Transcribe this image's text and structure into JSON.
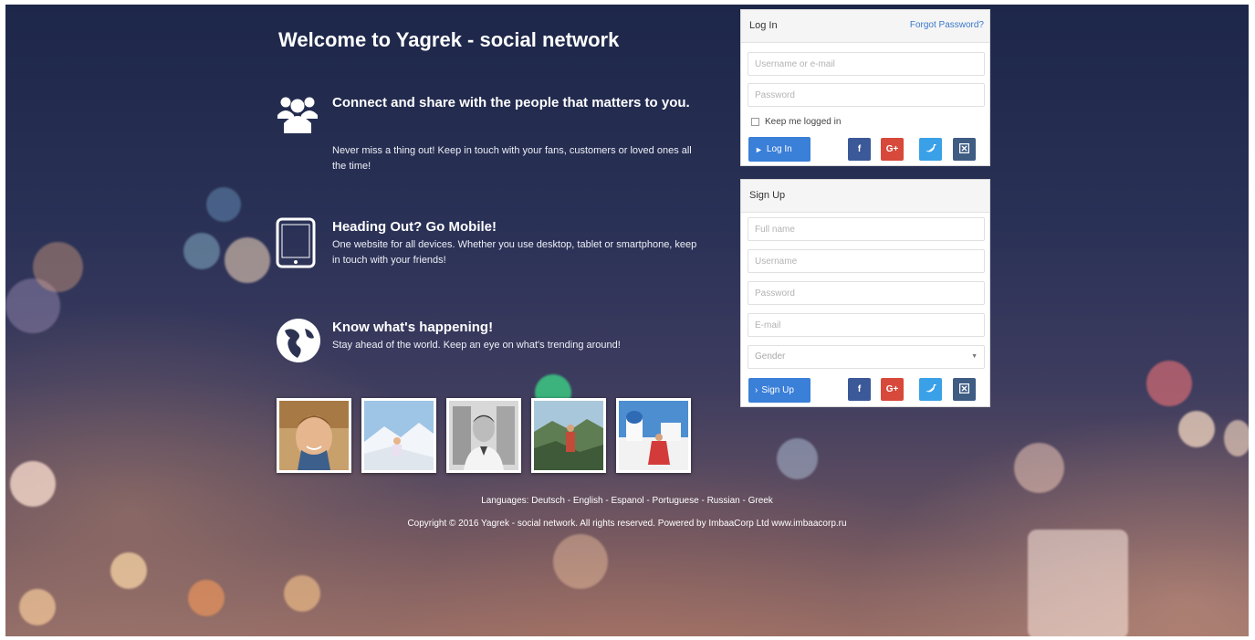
{
  "page": {
    "title": "Welcome to Yagrek - social network"
  },
  "features": [
    {
      "icon": "users-icon",
      "heading": "Connect and share with the people that matters to you.",
      "text": "Never miss a thing out! Keep in touch with your fans, customers or loved ones all the time!"
    },
    {
      "icon": "tablet-icon",
      "heading": "Heading Out? Go Mobile!",
      "text": "One website for all devices. Whether you use desktop, tablet or smartphone, keep in touch with your friends!"
    },
    {
      "icon": "globe-icon",
      "heading": "Know what's happening!",
      "text": "Stay ahead of the world. Keep an eye on what's trending around!"
    }
  ],
  "login": {
    "title": "Log In",
    "forgot_link": "Forgot Password?",
    "username_placeholder": "Username or e-mail",
    "password_placeholder": "Password",
    "remember_label": "Keep me logged in",
    "submit_label": "Log In",
    "submit_icon": "sign-in-icon",
    "social": [
      "f",
      "G+",
      "twitter-icon",
      "vk-icon"
    ]
  },
  "signup": {
    "title": "Sign Up",
    "fullname_placeholder": "Full name",
    "username_placeholder": "Username",
    "password_placeholder": "Password",
    "email_placeholder": "E-mail",
    "gender_placeholder": "Gender",
    "submit_label": "Sign Up",
    "submit_icon": "chevron-right-icon",
    "social": [
      "f",
      "G+",
      "twitter-icon",
      "vk-icon"
    ]
  },
  "footer": {
    "languages_label": "Languages:",
    "languages": "Deutsch - English - Espanol - Portuguese - Russian - Greek",
    "copyright": "Copyright © 2016 Yagrek - social network. All rights reserved. Powered by ImbaaCorp Ltd www.imbaacorp.ru"
  },
  "colors": {
    "primary_button": "#3a7fd8",
    "facebook": "#3b5998",
    "google": "#d7493a",
    "twitter": "#3aa1e8",
    "vk": "#3f5c83",
    "link": "#3a78c9"
  }
}
